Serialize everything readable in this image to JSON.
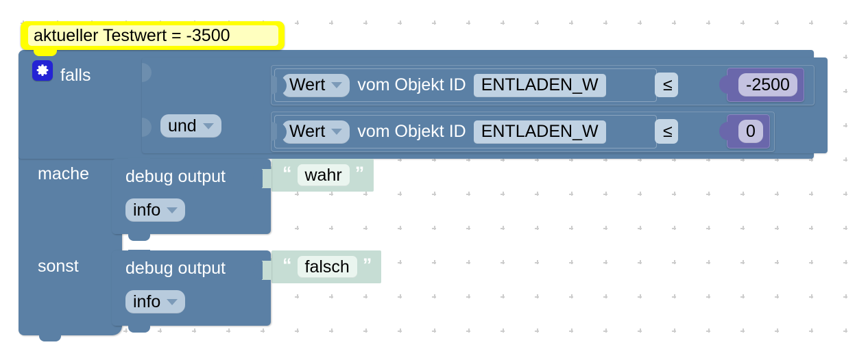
{
  "workspace": {
    "grid_color": "#cdcdcd",
    "background": "#ffffff"
  },
  "comment": {
    "text": "aktueller Testwert = -3500",
    "color": "#ffff00",
    "inner_color": "#ffffbf"
  },
  "if_block": {
    "color": "#5b80a5",
    "mutator_icon": "gear-icon",
    "if_label": "falls",
    "do_label": "mache",
    "else_label": "sonst"
  },
  "logic": {
    "operator_label": "und",
    "operator_icon": "chevron-down-icon"
  },
  "conditions": [
    {
      "getter_field": "Wert",
      "getter_caret": "chevron-down-icon",
      "getter_text": "vom Objekt ID",
      "object_id": "ENTLADEN_W",
      "operator": "≤",
      "operator_caret": "chevron-down-icon",
      "value": "-2500",
      "value_color": "#6a67ab"
    },
    {
      "getter_field": "Wert",
      "getter_caret": "chevron-down-icon",
      "getter_text": "vom Objekt ID",
      "object_id": "ENTLADEN_W",
      "operator": "≤",
      "operator_caret": "chevron-down-icon",
      "value": "0",
      "value_color": "#6a67ab"
    }
  ],
  "statements": [
    {
      "branch": "mache",
      "title": "debug output",
      "level": "info",
      "level_caret": "chevron-down-icon",
      "string_value": "wahr",
      "quote_open": "“",
      "quote_close": "”",
      "string_color": "#c6ddd4"
    },
    {
      "branch": "sonst",
      "title": "debug output",
      "level": "info",
      "level_caret": "chevron-down-icon",
      "string_value": "falsch",
      "quote_open": "“",
      "quote_close": "”",
      "string_color": "#c6ddd4"
    }
  ]
}
